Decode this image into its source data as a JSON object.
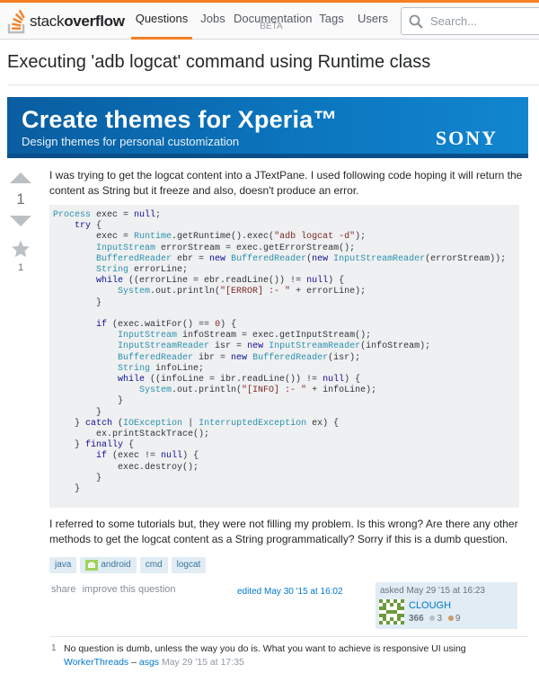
{
  "header": {
    "logo_prefix": "stack",
    "logo_suffix": "overflow",
    "nav": [
      {
        "label": "Questions"
      },
      {
        "label": "Jobs"
      },
      {
        "label": "Documentation",
        "badge": "BETA"
      },
      {
        "label": "Tags"
      },
      {
        "label": "Users"
      }
    ],
    "search_placeholder": "Search..."
  },
  "question": {
    "title": "Executing 'adb logcat' command using Runtime class",
    "votes": "1",
    "favorites": "1",
    "intro": "I was trying to get the logcat content into a JTextPane. I used following code hoping it will return the content as String but it freeze and also, doesn't produce an error.",
    "outro": "I referred to some tutorials but, they were not filling my problem. Is this wrong? Are there any other methods to get the logcat content as a String programmatically? Sorry if this is a dumb question.",
    "tags": [
      "java",
      "android",
      "cmd",
      "logcat"
    ],
    "menu": {
      "share": "share",
      "improve": "improve this question"
    },
    "edited": "edited May 30 '15 at 16:02",
    "asked": "asked May 29 '15 at 16:23",
    "user": "CLOUGH",
    "reputation": "366",
    "silver_badges": "3",
    "bronze_badges": "9"
  },
  "ad": {
    "headline": "Create themes for Xperia™",
    "subline": "Design themes for personal customization",
    "brand": "SONY"
  },
  "comment": {
    "score": "1",
    "text": "No question is dumb, unless the way you do is. What you want to achieve is responsive UI using",
    "link": "WorkerThreads",
    "separator": " – ",
    "user": "asgs",
    "date": "May 29 '15 at 17:35"
  },
  "colors": {
    "accent": "#f48024",
    "link": "#0077cc",
    "tag_bg": "#e1ecf4",
    "silver": "#bbc0c4",
    "bronze": "#cc9966"
  },
  "icons": {
    "logo": "stack-icon",
    "search": "search-icon",
    "upvote": "arrow-up-icon",
    "downvote": "arrow-down-icon",
    "favorite": "star-icon",
    "android": "android-icon"
  }
}
